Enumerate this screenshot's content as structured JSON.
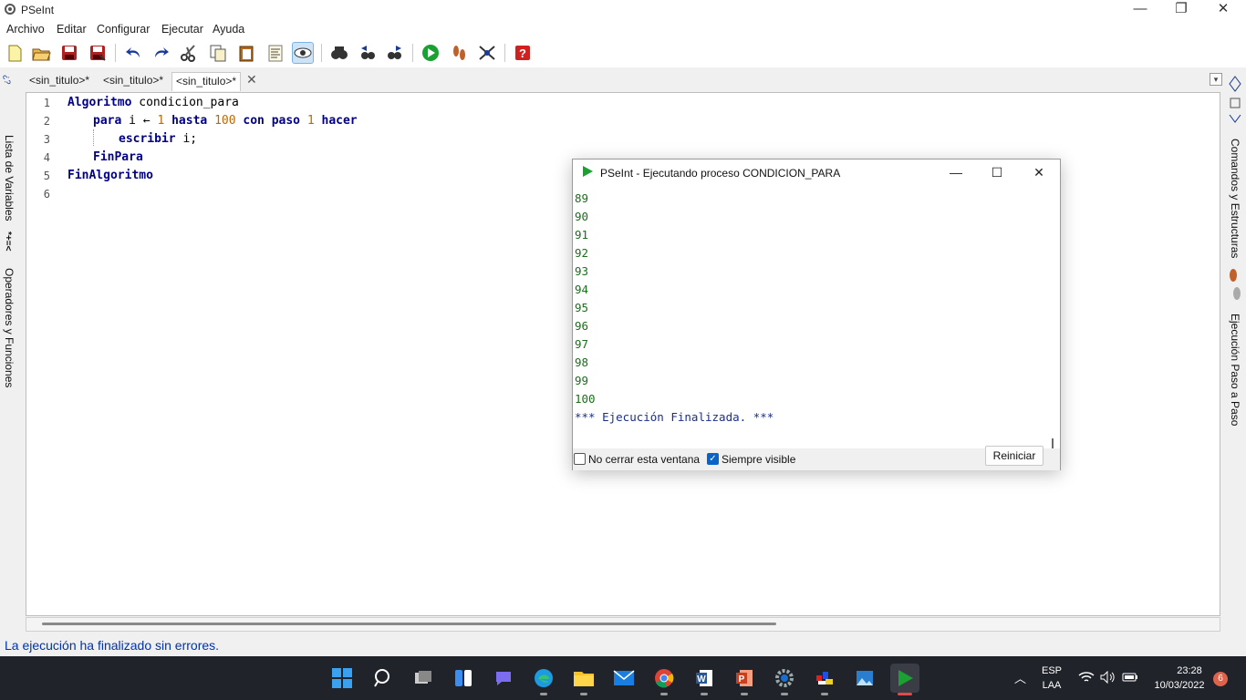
{
  "window": {
    "title": "PSeInt",
    "minimize": "—",
    "maximize": "❐",
    "close": "✕"
  },
  "menu": [
    "Archivo",
    "Editar",
    "Configurar",
    "Ejecutar",
    "Ayuda"
  ],
  "left_panel": {
    "variables_label": "Lista de Variables",
    "operators_label": "Operadores y Funciones"
  },
  "right_panel": {
    "commands_label": "Comandos y Estructuras",
    "step_label": "Ejecución Paso a Paso"
  },
  "tabs": [
    "<sin_titulo>*",
    "<sin_titulo>*",
    "<sin_titulo>*"
  ],
  "tab_close": "✕",
  "editor": {
    "line_numbers": [
      "1",
      "2",
      "3",
      "4",
      "5",
      "6"
    ],
    "line1": {
      "kw": "Algoritmo",
      "name": " condicion_para"
    },
    "line2": {
      "kw1": "para",
      "var": " i ← ",
      "n1": "1",
      "kw2": " hasta ",
      "n2": "100",
      "kw3": " con paso ",
      "n3": "1",
      "kw4": " hacer"
    },
    "line3": {
      "kw": "escribir",
      "rest": " i;"
    },
    "line4": {
      "kw": "FinPara"
    },
    "line5": {
      "kw": "FinAlgoritmo"
    }
  },
  "status": "La ejecución ha finalizado sin errores.",
  "run_window": {
    "title": "PSeInt - Ejecutando proceso CONDICION_PARA",
    "output": [
      "89",
      "90",
      "91",
      "92",
      "93",
      "94",
      "95",
      "96",
      "97",
      "98",
      "99",
      "100"
    ],
    "final": "*** Ejecución Finalizada. ***",
    "no_close_label": "No cerrar esta ventana",
    "always_visible_label": "Siempre visible",
    "restart_label": "Reiniciar",
    "always_visible_checked": true
  },
  "taskbar": {
    "lang": "ESP",
    "layout": "LAA",
    "time": "23:28",
    "date": "10/03/2022",
    "notifications": "6"
  }
}
